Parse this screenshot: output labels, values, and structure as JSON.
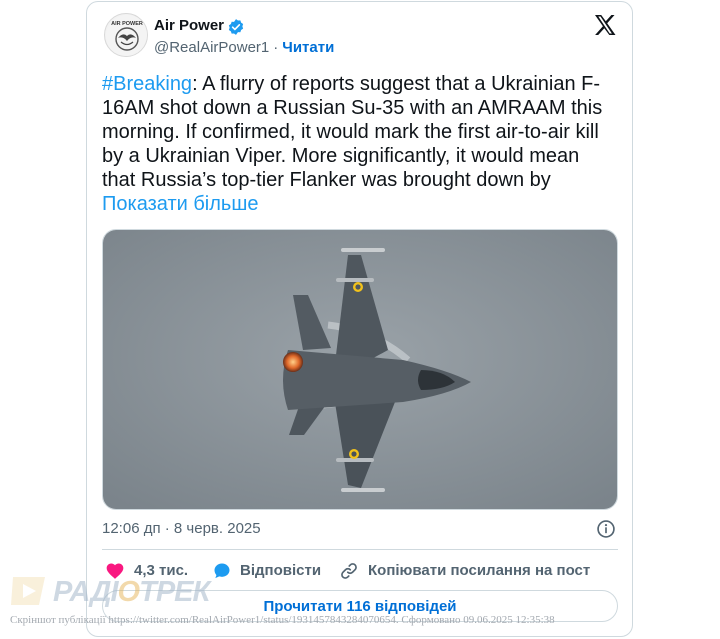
{
  "author": {
    "name": "Air Power",
    "handle": "@RealAirPower1",
    "follow_label": "Читати",
    "avatar_text": "AIR POWER"
  },
  "tweet": {
    "hashtag": "#Breaking",
    "body": ": A flurry of reports suggest that a Ukrainian F-16AM shot down a Russian Su-35 with an AMRAAM this morning. If confirmed, it would mark the first air-to-air kill by a Ukrainian Viper. More significantly, it would mean that Russia’s top-tier Flanker was brought down by ",
    "show_more": "Показати більше"
  },
  "meta": {
    "timestamp": "12:06 дп · 8 черв. 2025"
  },
  "actions": {
    "likes": "4,3 тис.",
    "reply": "Відповісти",
    "copy_link": "Копіювати посилання на пост"
  },
  "read_replies": "Прочитати 116 відповідей",
  "watermark": {
    "logo_text_a": "РАДІ",
    "logo_text_b": "О",
    "logo_text_c": "ТРЕК",
    "caption": "Скріншот публікації https://twitter.com/RealAirPower1/status/1931457843284070654. Сформовано 09.06.2025 12:35:38"
  },
  "colors": {
    "link": "#1d9bf0",
    "follow": "#006fd6",
    "heart": "#f91880",
    "verified": "#1d9bf0",
    "sky": "#8f989f"
  },
  "icons": [
    "verified-badge-icon",
    "x-logo-icon",
    "info-icon",
    "heart-icon",
    "reply-bubble-icon",
    "link-icon"
  ]
}
